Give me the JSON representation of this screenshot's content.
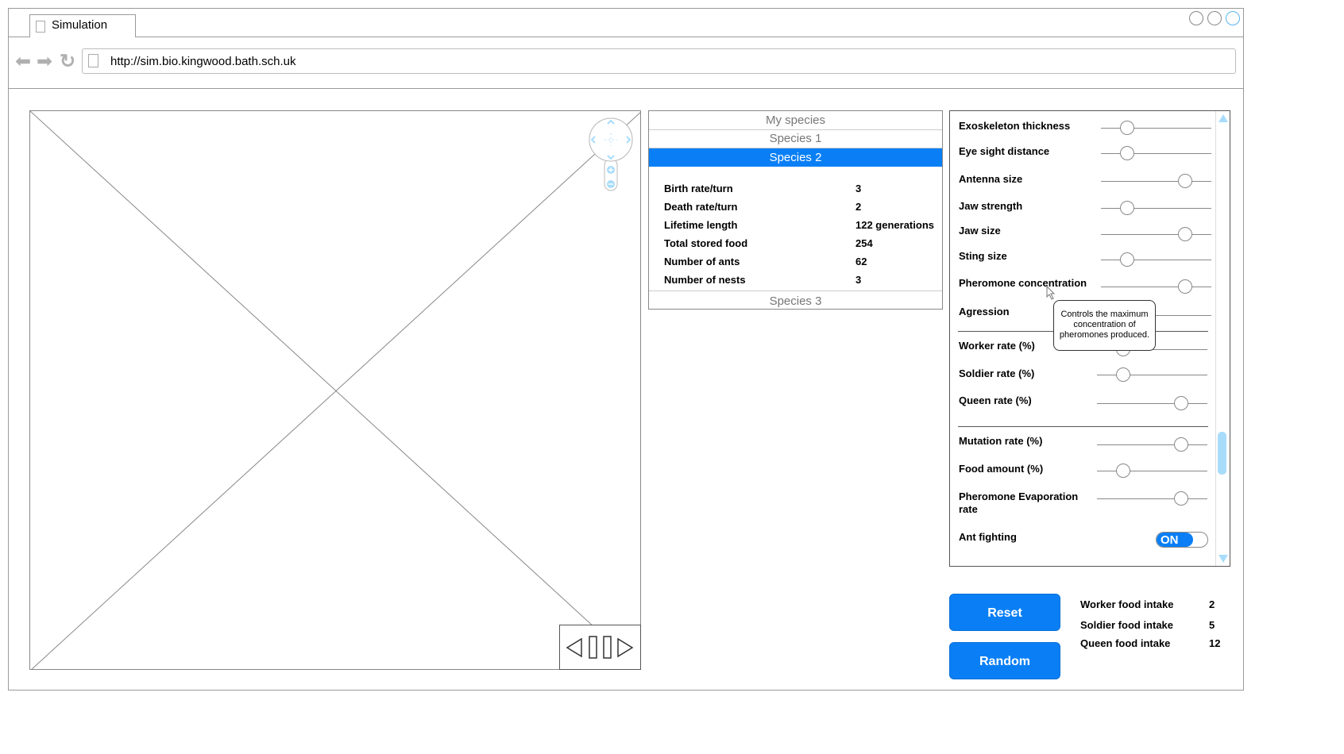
{
  "browser": {
    "tab_title": "Simulation",
    "url": "http://sim.bio.kingwood.bath.sch.uk",
    "nav_back_glyph": "⬅",
    "nav_forward_glyph": "➡",
    "nav_reload_glyph": "↻"
  },
  "species_panel": {
    "header": "My species",
    "species": [
      "Species 1",
      "Species 2",
      "Species 3"
    ],
    "selected": "Species 2",
    "stats": [
      {
        "label": "Birth rate/turn",
        "value": "3"
      },
      {
        "label": "Death rate/turn",
        "value": "2"
      },
      {
        "label": "Lifetime length",
        "value": "122 generations"
      },
      {
        "label": "Total stored food",
        "value": "254"
      },
      {
        "label": "Number of ants",
        "value": "62"
      },
      {
        "label": "Number of nests",
        "value": "3"
      }
    ]
  },
  "settings": {
    "sliders": [
      {
        "label": "Exoskeleton thickness",
        "value_fraction": 0.2
      },
      {
        "label": "Eye sight distance",
        "value_fraction": 0.2
      },
      {
        "label": "Antenna size",
        "value_fraction": 0.8
      },
      {
        "label": "Jaw strength",
        "value_fraction": 0.2
      },
      {
        "label": "Jaw size",
        "value_fraction": 0.8
      },
      {
        "label": "Sting size",
        "value_fraction": 0.2
      },
      {
        "label": "Pheromone concentration",
        "value_fraction": 0.8
      },
      {
        "label": "Agression",
        "value_fraction": 0.2
      },
      {
        "label": "Worker rate (%)",
        "value_fraction": 0.2
      },
      {
        "label": "Soldier rate (%)",
        "value_fraction": 0.2
      },
      {
        "label": "Queen rate (%)",
        "value_fraction": 0.8
      },
      {
        "label": "Mutation rate (%)",
        "value_fraction": 0.8
      },
      {
        "label": "Food amount (%)",
        "value_fraction": 0.2
      },
      {
        "label": "Pheromone Evaporation rate",
        "value_fraction": 0.8
      }
    ],
    "ant_fighting_label": "Ant fighting",
    "ant_fighting_state": "ON",
    "tooltip": "Controls the maximum concentration of pheromones produced."
  },
  "actions": {
    "reset_label": "Reset",
    "random_label": "Random"
  },
  "food_intake": [
    {
      "label": "Worker food intake",
      "value": "2"
    },
    {
      "label": "Soldier food intake",
      "value": "5"
    },
    {
      "label": "Queen food intake",
      "value": "12"
    }
  ],
  "colors": {
    "accent": "#0a7ff5",
    "map_control": "#a8dcfb"
  }
}
